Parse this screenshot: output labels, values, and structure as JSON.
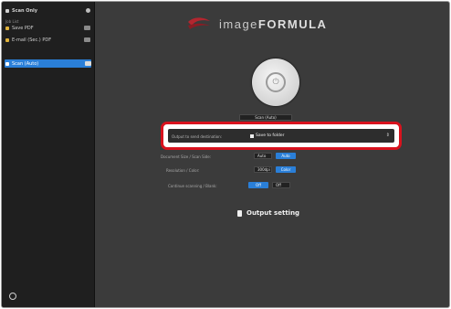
{
  "sidebar": {
    "header_label": "Scan Only",
    "caption": "Job List",
    "items": [
      {
        "label": "Save PDF"
      },
      {
        "label": "E-mail (Sec.) PDF"
      },
      {
        "label": "Scan (Auto)"
      }
    ],
    "settings_icon": "gear-icon"
  },
  "main": {
    "logo_text_light": "image",
    "logo_text_bold": "FORMULA",
    "scan_button_icon": "scan-icon",
    "top_pill": "Scan (Auto)",
    "destination": {
      "label": "Output to send destination:",
      "value": "Save to folder"
    },
    "rows": [
      {
        "label": "Document Size / Scan Side:",
        "value_left": "Auto",
        "value_right": "Auto"
      },
      {
        "label": "Resolution / Color:",
        "value_left": "300dpi",
        "value_right": "Color"
      },
      {
        "label": "Continue scanning / Blank:",
        "value_left": "Off",
        "value_right": "Off"
      }
    ],
    "output_setting_label": "Output setting"
  },
  "colors": {
    "accent": "#2a7fd8",
    "highlight": "#d8121d"
  }
}
